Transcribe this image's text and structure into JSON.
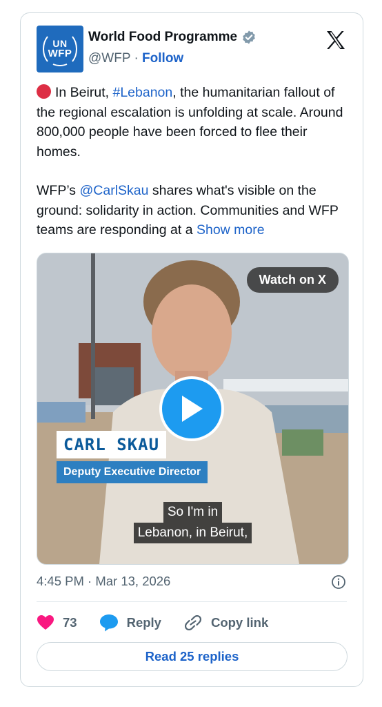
{
  "author": {
    "name": "World Food Programme",
    "handle": "@WFP",
    "separator": "·",
    "follow_label": "Follow",
    "avatar_top": "UN",
    "avatar_bottom": "WFP"
  },
  "tweet": {
    "para1_pre": "In Beirut, ",
    "para1_hashtag": "#Lebanon",
    "para1_post": ", the humanitarian fallout of the regional escalation is unfolding at scale. Around 800,000 people have been forced to flee their homes.",
    "para2_pre": "WFP’s ",
    "para2_mention": "@CarlSkau",
    "para2_post": " shares what's visible on the ground: solidarity in action. Communities and WFP teams are responding at a ",
    "show_more": "Show more"
  },
  "media": {
    "watch_label": "Watch on X",
    "name_tag": "CARL SKAU",
    "role_tag": "Deputy Executive Director",
    "subtitle_line1": "So I'm in",
    "subtitle_line2": "Lebanon, in Beirut,"
  },
  "meta": {
    "timestamp": "4:45 PM · Mar 13, 2026"
  },
  "actions": {
    "like_count": "73",
    "reply_label": "Reply",
    "copy_label": "Copy link",
    "read_replies": "Read 25 replies"
  },
  "colors": {
    "link": "#1d63c9",
    "heart": "#f91880",
    "play": "#1d9bf0"
  },
  "icons": [
    "verified-badge-icon",
    "x-logo-icon",
    "red-circle-icon",
    "play-icon",
    "info-icon",
    "heart-icon",
    "reply-bubble-icon",
    "link-icon"
  ]
}
